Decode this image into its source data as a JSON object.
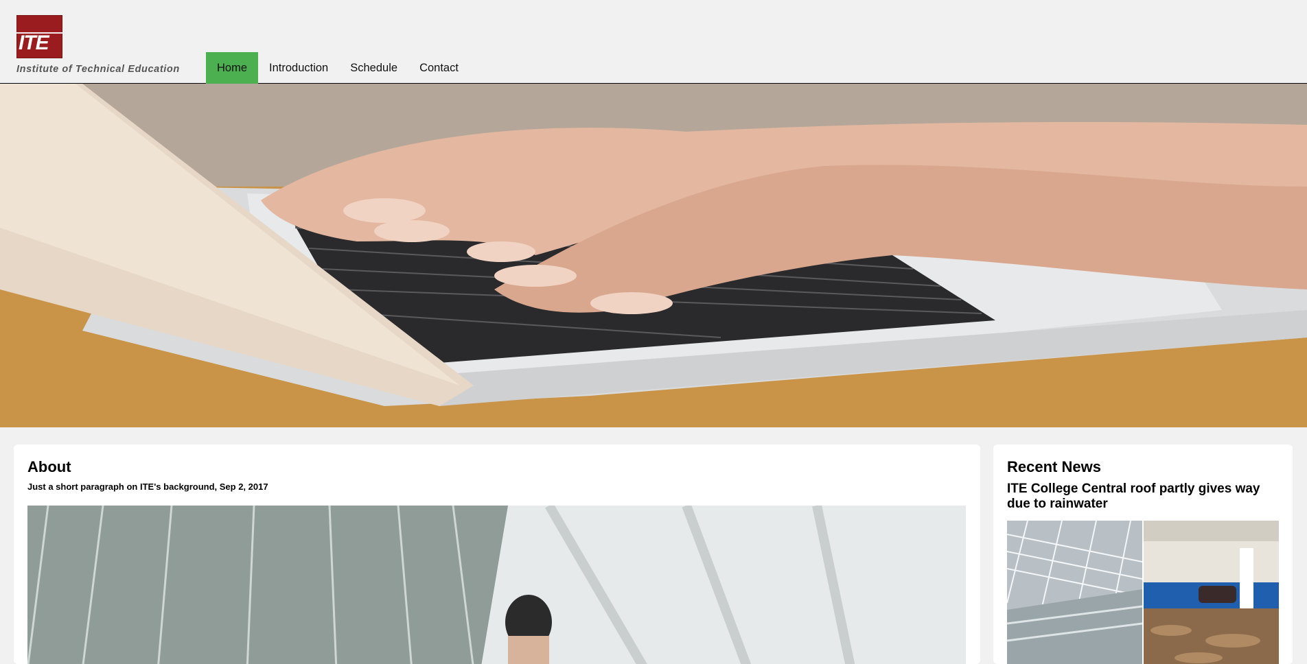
{
  "brand": {
    "logo_mark": "ITE",
    "name": "Institute of Technical Education",
    "logo_color": "#9b1c1f"
  },
  "nav": {
    "items": [
      {
        "label": "Home",
        "active": true
      },
      {
        "label": "Introduction",
        "active": false
      },
      {
        "label": "Schedule",
        "active": false
      },
      {
        "label": "Contact",
        "active": false
      }
    ],
    "active_color": "#4caf50"
  },
  "hero": {
    "image": "hands-typing-on-laptop-photo"
  },
  "about": {
    "title": "About",
    "subtitle": "Just a short paragraph on ITE's background, Sep 2, 2017",
    "image": "student-in-glass-building-photo"
  },
  "news": {
    "title": "Recent News",
    "headline": "ITE College Central roof partly gives way due to rainwater",
    "images": [
      "roof-structure-photo",
      "flooded-carpark-photo"
    ]
  }
}
